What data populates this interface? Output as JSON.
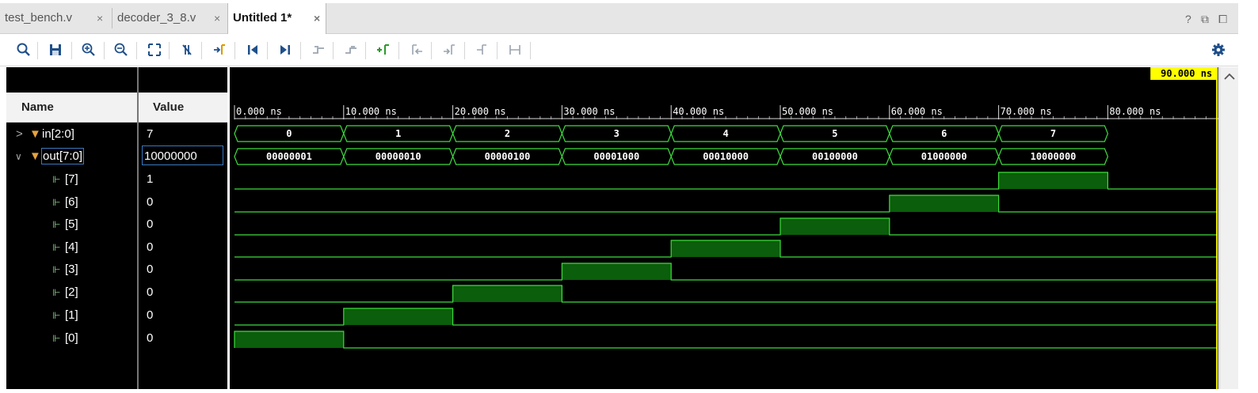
{
  "tabs": [
    {
      "label": "test_bench.v",
      "active": false
    },
    {
      "label": "decoder_3_8.v",
      "active": false
    },
    {
      "label": "Untitled 1*",
      "active": true
    }
  ],
  "tab_close": "×",
  "window_controls": {
    "help": "?",
    "restore": "⧉",
    "max": "⧠"
  },
  "toolbar": [
    "search-icon",
    "save-icon",
    "zoom-in-icon",
    "zoom-out-icon",
    "zoom-fit-icon",
    "swap-cursor-icon",
    "goto-cursor-icon",
    "goto-start-icon",
    "goto-end-icon",
    "prev-transition-icon",
    "next-transition-icon",
    "add-marker-icon",
    "prev-marker-icon",
    "next-marker-icon",
    "swap-marker-icon",
    "bracket-icon",
    "gear-icon"
  ],
  "headers": {
    "name": "Name",
    "value": "Value"
  },
  "cursor_label": "90.000 ns",
  "cursor_time": 90,
  "time_range": [
    0,
    90
  ],
  "time_ticks": [
    "0.000 ns",
    "10.000 ns",
    "20.000 ns",
    "30.000 ns",
    "40.000 ns",
    "50.000 ns",
    "60.000 ns",
    "70.000 ns",
    "80.000 ns"
  ],
  "signals": [
    {
      "name": "in[2:0]",
      "value": "7",
      "type": "bus",
      "expander": ">"
    },
    {
      "name": "out[7:0]",
      "value": "10000000",
      "type": "bus",
      "expander": "∨"
    },
    {
      "name": "[7]",
      "value": "1",
      "type": "bit"
    },
    {
      "name": "[6]",
      "value": "0",
      "type": "bit"
    },
    {
      "name": "[5]",
      "value": "0",
      "type": "bit"
    },
    {
      "name": "[4]",
      "value": "0",
      "type": "bit"
    },
    {
      "name": "[3]",
      "value": "0",
      "type": "bit"
    },
    {
      "name": "[2]",
      "value": "0",
      "type": "bit"
    },
    {
      "name": "[1]",
      "value": "0",
      "type": "bit"
    },
    {
      "name": "[0]",
      "value": "0",
      "type": "bit"
    }
  ],
  "bus_in_values": [
    "0",
    "1",
    "2",
    "3",
    "4",
    "5",
    "6",
    "7"
  ],
  "bus_out_values": [
    "00000001",
    "00000010",
    "00000100",
    "00001000",
    "00010000",
    "00100000",
    "01000000",
    "10000000"
  ],
  "colors": {
    "wave": "#3ddc3d",
    "fill": "#0b5e0b",
    "cursor": "#ffff00",
    "bg": "#000000"
  }
}
